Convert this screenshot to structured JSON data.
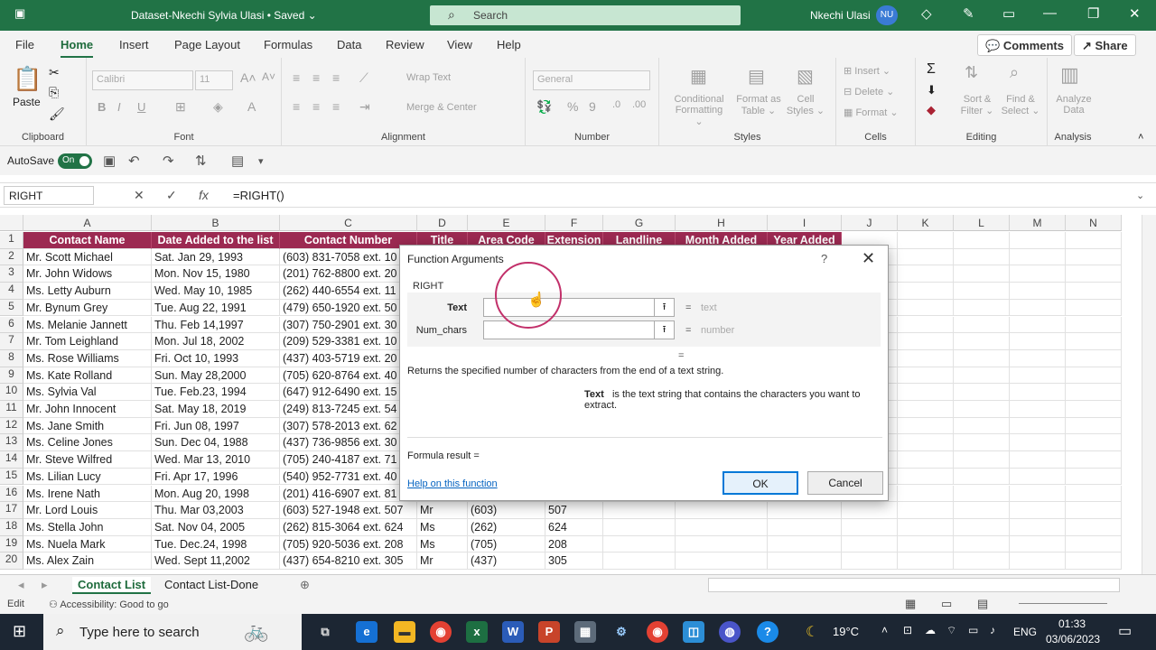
{
  "titlebar": {
    "doc": "Dataset-Nkechi Sylvia Ulasi • Saved ⌄",
    "search": "Search",
    "user": "Nkechi Ulasi",
    "initials": "NU"
  },
  "menu": {
    "tabs": [
      "File",
      "Home",
      "Insert",
      "Page Layout",
      "Formulas",
      "Data",
      "Review",
      "View",
      "Help"
    ],
    "comments": "Comments",
    "share": "Share"
  },
  "ribbon": {
    "paste": "Paste",
    "font_name": "Calibri",
    "font_size": "11",
    "number_format": "General",
    "wrap": "Wrap Text",
    "merge": "Merge & Center",
    "cond": [
      "Conditional",
      "Formatting ⌄"
    ],
    "format_table": [
      "Format as",
      "Table ⌄"
    ],
    "cell_styles": [
      "Cell",
      "Styles ⌄"
    ],
    "insert": "Insert",
    "delete": "Delete",
    "format": "Format",
    "sort": [
      "Sort &",
      "Filter ⌄"
    ],
    "find": [
      "Find &",
      "Select ⌄"
    ],
    "analyze": [
      "Analyze",
      "Data"
    ],
    "groups": [
      "Clipboard",
      "Font",
      "Alignment",
      "Number",
      "Styles",
      "Cells",
      "Editing",
      "Analysis"
    ]
  },
  "qat": {
    "autosave": "AutoSave",
    "toggle": "On"
  },
  "formula_bar": {
    "namebox": "RIGHT",
    "formula": "=RIGHT()"
  },
  "columns": [
    "A",
    "B",
    "C",
    "D",
    "E",
    "F",
    "G",
    "H",
    "I",
    "J",
    "K",
    "L",
    "M",
    "N"
  ],
  "headers": [
    "Contact Name",
    "Date Added to the list",
    "Contact Number",
    "Title",
    "Area Code",
    "Extension",
    "Landline",
    "Month Added",
    "Year Added"
  ],
  "rows": [
    [
      "Mr. Scott Michael",
      "Sat. Jan 29, 1993",
      "(603) 831-7058 ext. 10",
      "",
      "",
      "",
      "",
      "",
      ""
    ],
    [
      "Mr. John Widows",
      "Mon. Nov 15, 1980",
      "(201) 762-8800 ext. 20",
      "",
      "",
      "",
      "",
      "",
      ""
    ],
    [
      "Ms. Letty Auburn",
      "Wed. May 10, 1985",
      "(262) 440-6554 ext. 11",
      "",
      "",
      "",
      "",
      "",
      ""
    ],
    [
      "Mr. Bynum Grey",
      "Tue. Aug 22, 1991",
      "(479) 650-1920 ext. 50",
      "",
      "",
      "",
      "",
      "",
      ""
    ],
    [
      "Ms. Melanie Jannett",
      "Thu. Feb 14,1997",
      "(307) 750-2901 ext. 30",
      "",
      "",
      "",
      "",
      "",
      ""
    ],
    [
      "Mr. Tom Leighland",
      "Mon. Jul 18, 2002",
      "(209) 529-3381 ext. 10",
      "",
      "",
      "",
      "",
      "",
      ""
    ],
    [
      "Ms. Rose Williams",
      "Fri. Oct 10, 1993",
      "(437) 403-5719 ext. 20",
      "",
      "",
      "",
      "",
      "",
      ""
    ],
    [
      "Ms. Kate Rolland",
      "Sun. May 28,2000",
      "(705) 620-8764 ext. 40",
      "",
      "",
      "",
      "",
      "",
      ""
    ],
    [
      "Ms. Sylvia Val",
      "Tue. Feb.23, 1994",
      "(647) 912-6490 ext. 15",
      "",
      "",
      "",
      "",
      "",
      ""
    ],
    [
      "Mr. John Innocent",
      "Sat. May 18, 2019",
      "(249) 813-7245 ext. 54",
      "",
      "",
      "",
      "",
      "",
      ""
    ],
    [
      "Ms. Jane Smith",
      "Fri. Jun 08, 1997",
      "(307) 578-2013 ext. 62",
      "",
      "",
      "",
      "",
      "",
      ""
    ],
    [
      "Ms. Celine Jones",
      "Sun. Dec 04, 1988",
      "(437) 736-9856 ext. 30",
      "",
      "",
      "",
      "",
      "",
      ""
    ],
    [
      "Mr. Steve Wilfred",
      "Wed. Mar 13, 2010",
      "(705) 240-4187 ext. 71",
      "",
      "",
      "",
      "",
      "",
      ""
    ],
    [
      "Ms. Lilian Lucy",
      "Fri. Apr 17, 1996",
      "(540) 952-7731 ext. 40",
      "",
      "",
      "",
      "",
      "",
      ""
    ],
    [
      "Ms. Irene Nath",
      "Mon. Aug 20, 1998",
      "(201) 416-6907 ext. 81",
      "",
      "",
      "",
      "",
      "",
      ""
    ],
    [
      "Mr. Lord Louis",
      "Thu. Mar 03,2003",
      "(603) 527-1948 ext. 507",
      "Mr",
      "(603)",
      "507",
      "",
      "",
      ""
    ],
    [
      "Ms. Stella John",
      "Sat. Nov 04, 2005",
      "(262) 815-3064 ext. 624",
      "Ms",
      "(262)",
      "624",
      "",
      "",
      ""
    ],
    [
      "Ms. Nuela Mark",
      "Tue. Dec.24, 1998",
      "(705) 920-5036 ext. 208",
      "Ms",
      "(705)",
      "208",
      "",
      "",
      ""
    ],
    [
      "Ms. Alex Zain",
      "Wed. Sept 11,2002",
      "(437) 654-8210 ext. 305",
      "Mr",
      "(437)",
      "305",
      "",
      "",
      ""
    ]
  ],
  "sheets": [
    "Contact List",
    "Contact List-Done"
  ],
  "status": {
    "mode": "Edit",
    "accessibility": "Accessibility: Good to go"
  },
  "dialog": {
    "title": "Function Arguments",
    "help_q": "?",
    "close": "✕",
    "fname": "RIGHT",
    "args": [
      {
        "label": "Text",
        "hint": "text"
      },
      {
        "label": "Num_chars",
        "hint": "number"
      }
    ],
    "description": "Returns the specified number of characters from the end of a text string.",
    "arg_help_name": "Text",
    "arg_help_text": "is the text string that contains the characters you want to extract.",
    "result": "Formula result =",
    "help_link": "Help on this function",
    "ok": "OK",
    "cancel": "Cancel"
  },
  "taskbar": {
    "search": "Type here to search",
    "temp": "19°C",
    "lang": "ENG",
    "time": "01:33",
    "date": "03/06/2023"
  }
}
